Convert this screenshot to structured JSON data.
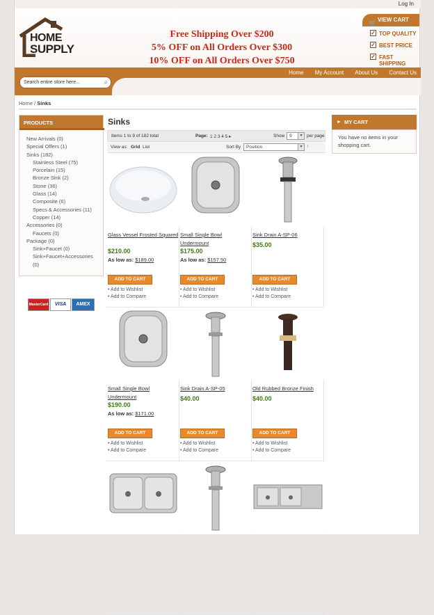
{
  "header": {
    "login": "Log In",
    "logo_line1": "HOME",
    "logo_line2": "SUPPLY",
    "promo": [
      "Free Shipping Over $200",
      "5% OFF on All Orders Over $300",
      "10% OFF on All Orders Over $750"
    ],
    "view_cart": "VIEW CART",
    "features": [
      "TOP QUALITY",
      "BEST PRICE",
      "FAST SHIPPING"
    ],
    "nav": [
      "Home",
      "My Account",
      "About Us",
      "Contact Us"
    ],
    "search_placeholder": "Search entire store here..."
  },
  "breadcrumb": {
    "home": "Home",
    "sep": " / ",
    "current": "Sinks"
  },
  "sidebar": {
    "title": "PRODUCTS",
    "items": [
      {
        "label": "New Arrivals (0)",
        "indent": false
      },
      {
        "label": "Special Offers (1)",
        "indent": false
      },
      {
        "label": "Sinks (182)",
        "indent": false
      },
      {
        "label": "Stainless Steel (75)",
        "indent": true
      },
      {
        "label": "Porcelain (15)",
        "indent": true
      },
      {
        "label": "Bronze Sink (2)",
        "indent": true
      },
      {
        "label": "Stone (36)",
        "indent": true
      },
      {
        "label": "Glass (14)",
        "indent": true
      },
      {
        "label": "Composite (6)",
        "indent": true
      },
      {
        "label": "Specs & Accessories (11)",
        "indent": true
      },
      {
        "label": "Copper (14)",
        "indent": true
      },
      {
        "label": "Accessories (0)",
        "indent": false
      },
      {
        "label": "Faucets (0)",
        "indent": true
      },
      {
        "label": "Package (0)",
        "indent": false
      },
      {
        "label": "Sink+Faucet (0)",
        "indent": true
      },
      {
        "label": "Sink+Faucet+Accessories",
        "indent": true
      },
      {
        "label": "(0)",
        "indent": true
      }
    ],
    "cards": [
      "MasterCard",
      "VISA",
      "AMEX"
    ]
  },
  "main": {
    "title": "Sinks",
    "items_info": "Items 1 to 9 of 182 total",
    "page_label": "Page:",
    "pages": "1  2  3  4  5  ▸",
    "show_label": "Show",
    "show_value": "9",
    "per_page": "per page",
    "view_as": "View as:",
    "view_grid": "Grid",
    "view_list": "List",
    "sort_by": "Sort By",
    "sort_value": "Position",
    "add_to_cart": "ADD TO CART",
    "wishlist": "Add to Wishlist",
    "compare": "Add to Compare",
    "low_label": "As low as:",
    "products": [
      {
        "name": "Glass Vessel Frosted Squared",
        "price": "$210.00",
        "low": "$189.00",
        "img": "glass"
      },
      {
        "name": "Small Single Bowl Undermount",
        "price": "$175.00",
        "low": "$157.50",
        "img": "steel-bowl"
      },
      {
        "name": "Sink Drain A-SP-06",
        "price": "$35.00",
        "low": "",
        "img": "drain"
      },
      {
        "name": "Small Single Bowl Undermount",
        "price": "$190.00",
        "low": "$171.00",
        "img": "steel-bowl"
      },
      {
        "name": "Sink Drain A-SP-05",
        "price": "$40.00",
        "low": "",
        "img": "drain-chrome"
      },
      {
        "name": "Old Rubbed Bronze Finish",
        "price": "$40.00",
        "low": "",
        "img": "drain-bronze"
      },
      {
        "name": "",
        "price": "",
        "low": "",
        "img": "double-bowl"
      },
      {
        "name": "",
        "price": "",
        "low": "",
        "img": "drain-chrome"
      },
      {
        "name": "",
        "price": "",
        "low": "",
        "img": "triple"
      }
    ]
  },
  "cart": {
    "title": "MY CART",
    "empty": "You have no items in your shopping cart."
  }
}
